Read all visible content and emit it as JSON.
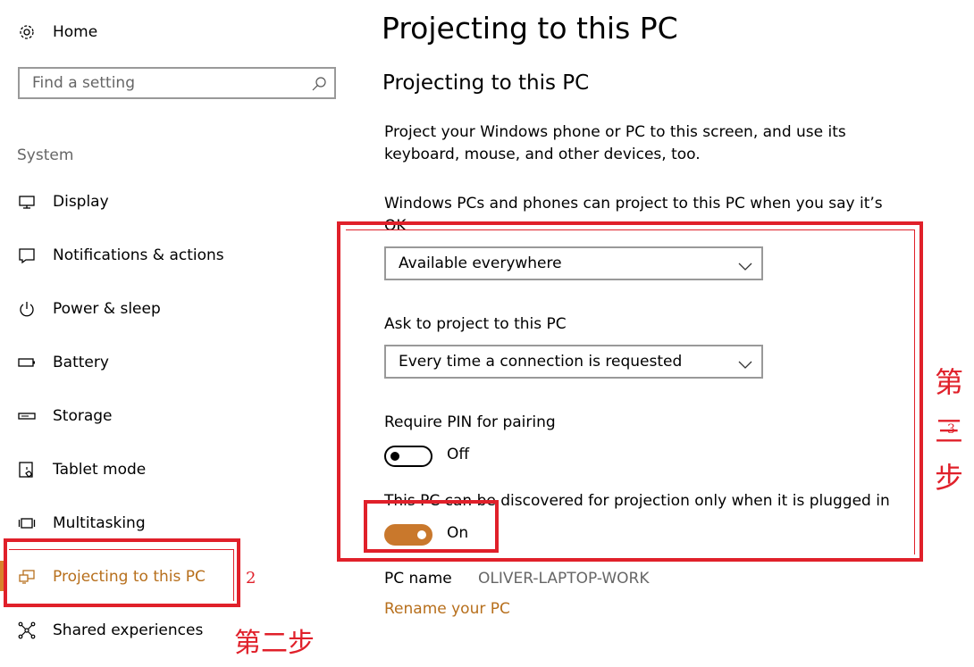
{
  "sidebar": {
    "home_label": "Home",
    "search_placeholder": "Find a setting",
    "section_label": "System",
    "items": [
      {
        "label": "Display",
        "icon": "monitor-icon"
      },
      {
        "label": "Notifications & actions",
        "icon": "message-icon"
      },
      {
        "label": "Power & sleep",
        "icon": "power-icon"
      },
      {
        "label": "Battery",
        "icon": "battery-icon"
      },
      {
        "label": "Storage",
        "icon": "storage-icon"
      },
      {
        "label": "Tablet mode",
        "icon": "tablet-icon"
      },
      {
        "label": "Multitasking",
        "icon": "multitasking-icon"
      },
      {
        "label": "Projecting to this PC",
        "icon": "projecting-icon",
        "active": true
      },
      {
        "label": "Shared experiences",
        "icon": "share-icon"
      }
    ]
  },
  "main": {
    "page_title": "Projecting to this PC",
    "section_title": "Projecting to this PC",
    "description": "Project your Windows phone or PC to this screen, and use its keyboard, mouse, and other devices, too.",
    "availability_label": "Windows PCs and phones can project to this PC when you say it’s OK",
    "availability_value": "Available everywhere",
    "ask_label": "Ask to project to this PC",
    "ask_value": "Every time a connection is requested",
    "pin_label": "Require PIN for pairing",
    "pin_state": "Off",
    "plugged_label": "This PC can be discovered for projection only when it is plugged in",
    "plugged_state": "On",
    "pc_name_label": "PC name",
    "pc_name_value": "OLIVER-LAPTOP-WORK",
    "rename_link": "Rename your PC"
  },
  "annotations": {
    "step2_number": "2",
    "step2_text": "第二步",
    "step3_text": [
      "第",
      "三",
      "步"
    ],
    "step3_number": "3"
  },
  "colors": {
    "accent": "#c9782c",
    "accent_text": "#b76f1c",
    "annotation_red": "#e0202a"
  }
}
